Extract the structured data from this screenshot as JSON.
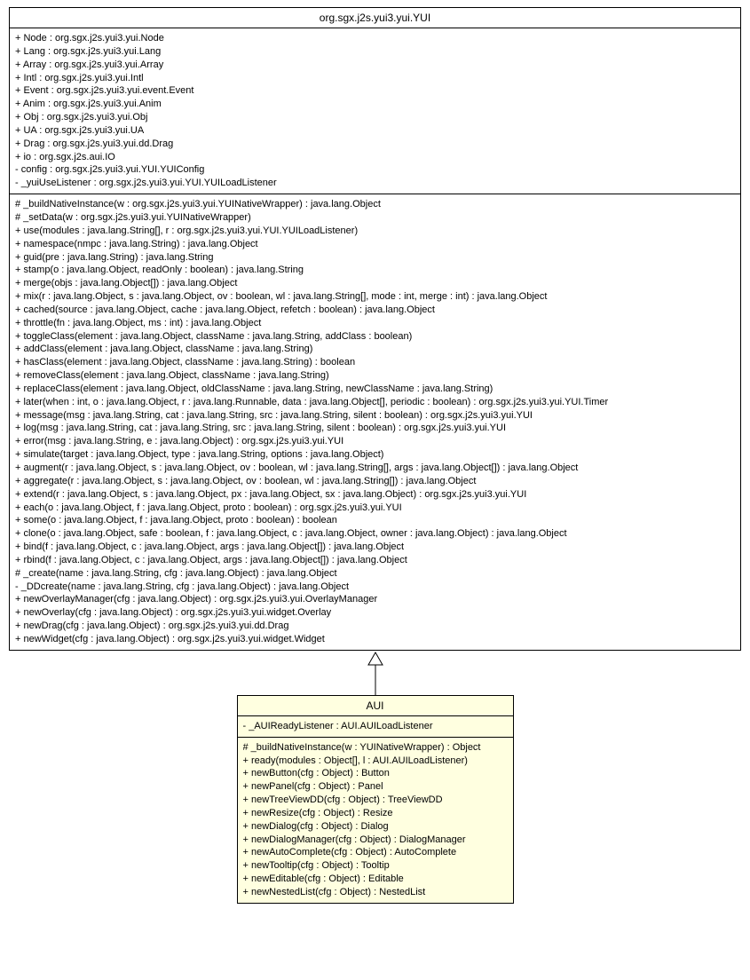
{
  "parent": {
    "name": "org.sgx.j2s.yui3.yui.YUI",
    "attributes": [
      "+ Node : org.sgx.j2s.yui3.yui.Node",
      "+ Lang : org.sgx.j2s.yui3.yui.Lang",
      "+ Array : org.sgx.j2s.yui3.yui.Array",
      "+ Intl : org.sgx.j2s.yui3.yui.Intl",
      "+ Event : org.sgx.j2s.yui3.yui.event.Event",
      "+ Anim : org.sgx.j2s.yui3.yui.Anim",
      "+ Obj : org.sgx.j2s.yui3.yui.Obj",
      "+ UA : org.sgx.j2s.yui3.yui.UA",
      "+ Drag : org.sgx.j2s.yui3.yui.dd.Drag",
      "+ io : org.sgx.j2s.aui.IO",
      "- config : org.sgx.j2s.yui3.yui.YUI.YUIConfig",
      "- _yuiUseListener : org.sgx.j2s.yui3.yui.YUI.YUILoadListener"
    ],
    "methods": [
      "# _buildNativeInstance(w : org.sgx.j2s.yui3.yui.YUINativeWrapper) : java.lang.Object",
      "# _setData(w : org.sgx.j2s.yui3.yui.YUINativeWrapper)",
      "+ use(modules : java.lang.String[], r : org.sgx.j2s.yui3.yui.YUI.YUILoadListener)",
      "+ namespace(nmpc : java.lang.String) : java.lang.Object",
      "+ guid(pre : java.lang.String) : java.lang.String",
      "+ stamp(o : java.lang.Object, readOnly : boolean) : java.lang.String",
      "+ merge(objs : java.lang.Object[]) : java.lang.Object",
      "+ mix(r : java.lang.Object, s : java.lang.Object, ov : boolean, wl : java.lang.String[], mode : int, merge : int) : java.lang.Object",
      "+ cached(source : java.lang.Object, cache : java.lang.Object, refetch : boolean) : java.lang.Object",
      "+ throttle(fn : java.lang.Object, ms : int) : java.lang.Object",
      "+ toggleClass(element : java.lang.Object, className : java.lang.String, addClass : boolean)",
      "+ addClass(element : java.lang.Object, className : java.lang.String)",
      "+ hasClass(element : java.lang.Object, className : java.lang.String) : boolean",
      "+ removeClass(element : java.lang.Object, className : java.lang.String)",
      "+ replaceClass(element : java.lang.Object, oldClassName : java.lang.String, newClassName : java.lang.String)",
      "+ later(when : int, o : java.lang.Object, r : java.lang.Runnable, data : java.lang.Object[], periodic : boolean) : org.sgx.j2s.yui3.yui.YUI.Timer",
      "+ message(msg : java.lang.String, cat : java.lang.String, src : java.lang.String, silent : boolean) : org.sgx.j2s.yui3.yui.YUI",
      "+ log(msg : java.lang.String, cat : java.lang.String, src : java.lang.String, silent : boolean) : org.sgx.j2s.yui3.yui.YUI",
      "+ error(msg : java.lang.String, e : java.lang.Object) : org.sgx.j2s.yui3.yui.YUI",
      "+ simulate(target : java.lang.Object, type : java.lang.String, options : java.lang.Object)",
      "+ augment(r : java.lang.Object, s : java.lang.Object, ov : boolean, wl : java.lang.String[], args : java.lang.Object[]) : java.lang.Object",
      "+ aggregate(r : java.lang.Object, s : java.lang.Object, ov : boolean, wl : java.lang.String[]) : java.lang.Object",
      "+ extend(r : java.lang.Object, s : java.lang.Object, px : java.lang.Object, sx : java.lang.Object) : org.sgx.j2s.yui3.yui.YUI",
      "+ each(o : java.lang.Object, f : java.lang.Object, proto : boolean) : org.sgx.j2s.yui3.yui.YUI",
      "+ some(o : java.lang.Object, f : java.lang.Object, proto : boolean) : boolean",
      "+ clone(o : java.lang.Object, safe : boolean, f : java.lang.Object, c : java.lang.Object, owner : java.lang.Object) : java.lang.Object",
      "+ bind(f : java.lang.Object, c : java.lang.Object, args : java.lang.Object[]) : java.lang.Object",
      "+ rbind(f : java.lang.Object, c : java.lang.Object, args : java.lang.Object[]) : java.lang.Object",
      "# _create(name : java.lang.String, cfg : java.lang.Object) : java.lang.Object",
      "- _DDcreate(name : java.lang.String, cfg : java.lang.Object) : java.lang.Object",
      "+ newOverlayManager(cfg : java.lang.Object) : org.sgx.j2s.yui3.yui.OverlayManager",
      "+ newOverlay(cfg : java.lang.Object) : org.sgx.j2s.yui3.yui.widget.Overlay",
      "+ newDrag(cfg : java.lang.Object) : org.sgx.j2s.yui3.yui.dd.Drag",
      "+ newWidget(cfg : java.lang.Object) : org.sgx.j2s.yui3.yui.widget.Widget"
    ]
  },
  "child": {
    "name": "AUI",
    "attributes": [
      "- _AUIReadyListener : AUI.AUILoadListener"
    ],
    "methods": [
      "# _buildNativeInstance(w : YUINativeWrapper) : Object",
      "+ ready(modules : Object[], l : AUI.AUILoadListener)",
      "+ newButton(cfg : Object) : Button",
      "+ newPanel(cfg : Object) : Panel",
      "+ newTreeViewDD(cfg : Object) : TreeViewDD",
      "+ newResize(cfg : Object) : Resize",
      "+ newDialog(cfg : Object) : Dialog",
      "+ newDialogManager(cfg : Object) : DialogManager",
      "+ newAutoComplete(cfg : Object) : AutoComplete",
      "+ newTooltip(cfg : Object) : Tooltip",
      "+ newEditable(cfg : Object) : Editable",
      "+ newNestedList(cfg : Object) : NestedList"
    ]
  }
}
